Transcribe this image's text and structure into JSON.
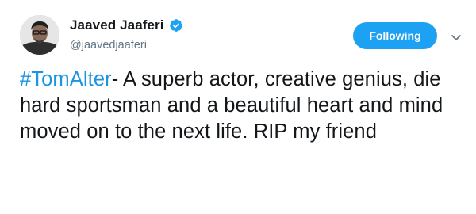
{
  "author": {
    "display_name": "Jaaved Jaaferi",
    "handle": "@jaavedjaaferi",
    "verified_icon": "verified-badge-icon",
    "avatar_icon": "avatar-portrait"
  },
  "actions": {
    "follow_label": "Following",
    "menu_icon": "chevron-down-icon"
  },
  "tweet": {
    "hashtag": "#TomAlter",
    "text": "- A superb actor, creative genius, die hard sportsman and a beautiful heart and mind moved on to the next life. RIP my friend"
  },
  "colors": {
    "accent": "#1da1f2",
    "hashtag": "#1b95e0",
    "secondary_text": "#657786"
  }
}
